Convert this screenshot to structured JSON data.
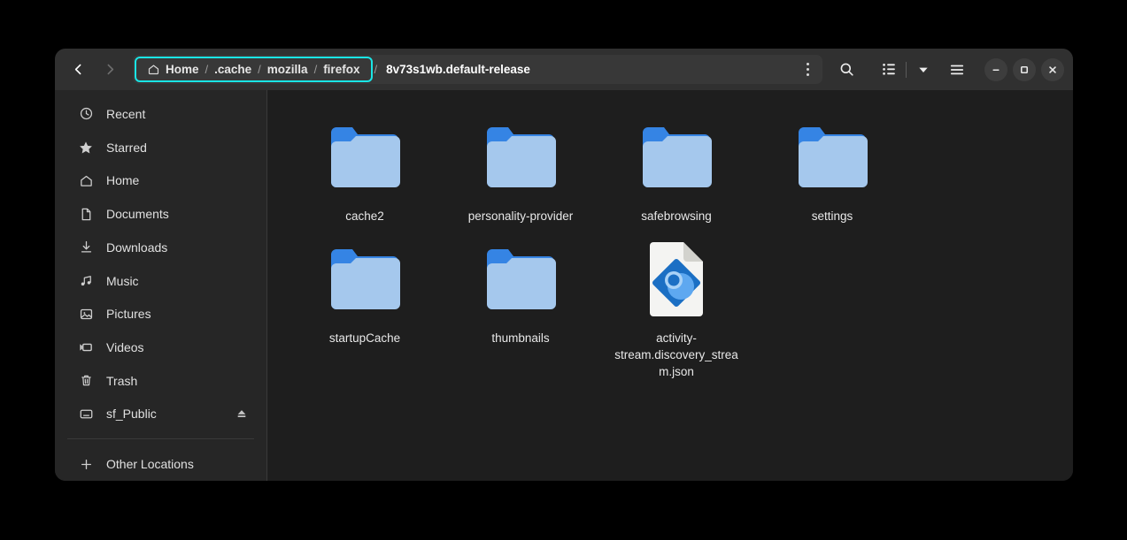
{
  "window": {
    "nav": {
      "back_icon": "chevron-left-icon",
      "forward_icon": "chevron-right-icon"
    },
    "breadcrumbs": [
      {
        "label": "Home",
        "icon": "home-icon"
      },
      {
        "label": ".cache"
      },
      {
        "label": "mozilla"
      },
      {
        "label": "firefox"
      }
    ],
    "crumb_separator": "/",
    "current_folder": "8v73s1wb.default-release",
    "focus_color": "#1ae5e5",
    "path_menu_icon": "kebab-menu-icon",
    "search_icon": "search-icon",
    "view_list_icon": "list-view-icon",
    "view_dropdown_icon": "chevron-down-icon",
    "main_menu_icon": "hamburger-menu-icon",
    "minimize_icon": "minimize-icon",
    "maximize_icon": "maximize-icon",
    "close_icon": "close-icon"
  },
  "sidebar": {
    "items": [
      {
        "label": "Recent",
        "icon": "clock-icon"
      },
      {
        "label": "Starred",
        "icon": "star-icon"
      },
      {
        "label": "Home",
        "icon": "home-icon"
      },
      {
        "label": "Documents",
        "icon": "document-icon"
      },
      {
        "label": "Downloads",
        "icon": "download-icon"
      },
      {
        "label": "Music",
        "icon": "music-icon"
      },
      {
        "label": "Pictures",
        "icon": "picture-icon"
      },
      {
        "label": "Videos",
        "icon": "video-icon"
      },
      {
        "label": "Trash",
        "icon": "trash-icon"
      },
      {
        "label": "sf_Public",
        "icon": "drive-icon",
        "eject": true,
        "eject_icon": "eject-icon"
      }
    ],
    "other_locations": {
      "label": "Other Locations",
      "icon": "plus-icon"
    }
  },
  "files": [
    {
      "name": "cache2",
      "type": "folder"
    },
    {
      "name": "personality-provider",
      "type": "folder"
    },
    {
      "name": "safebrowsing",
      "type": "folder"
    },
    {
      "name": "settings",
      "type": "folder"
    },
    {
      "name": "startupCache",
      "type": "folder"
    },
    {
      "name": "thumbnails",
      "type": "folder"
    },
    {
      "name": "activity-stream.discovery_stream.json",
      "type": "file",
      "file_icon": "json-config-file-icon"
    }
  ],
  "colors": {
    "folder_tab": "#3584e4",
    "folder_body": "#a5c8ed",
    "accent": "#1ae5e5"
  }
}
